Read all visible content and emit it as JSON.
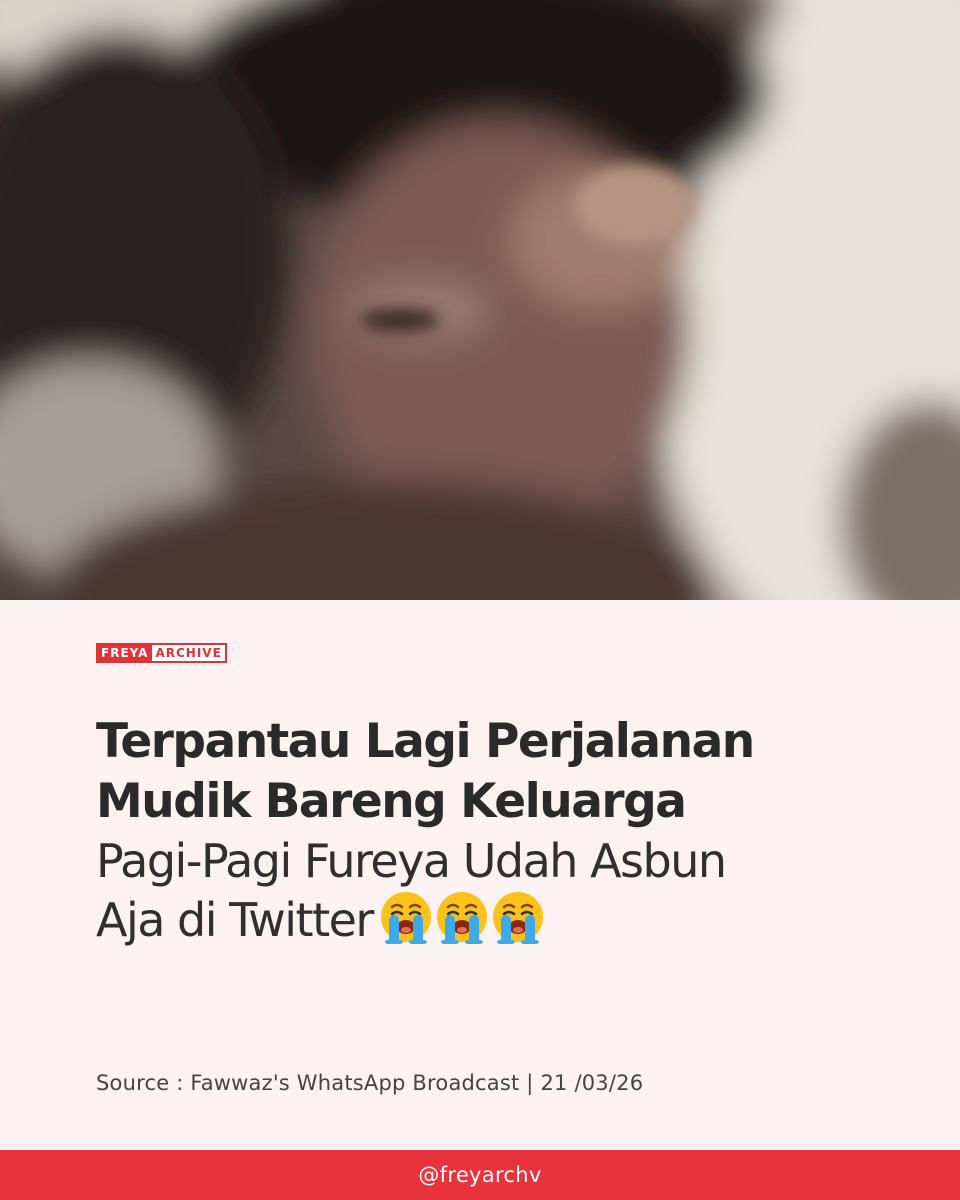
{
  "brand": {
    "part1": "FREYA",
    "part2": "ARCHIVE",
    "accent_color": "#e0323a"
  },
  "headline": {
    "bold_line1": "Terpantau Lagi Perjalanan",
    "bold_line2": "Mudik Bareng Keluarga",
    "light_line1": "Pagi-Pagi Fureya Udah Asbun",
    "light_line2": "Aja di Twitter",
    "emoji": [
      "loudly-crying-face",
      "loudly-crying-face",
      "loudly-crying-face"
    ]
  },
  "source": {
    "text": "Source : Fawwaz's WhatsApp Broadcast | 21 /03/26"
  },
  "footer": {
    "handle": "@freyarchv",
    "bar_color": "#e8333d"
  },
  "photo": {
    "description_icon": "blurred-person-photo"
  }
}
